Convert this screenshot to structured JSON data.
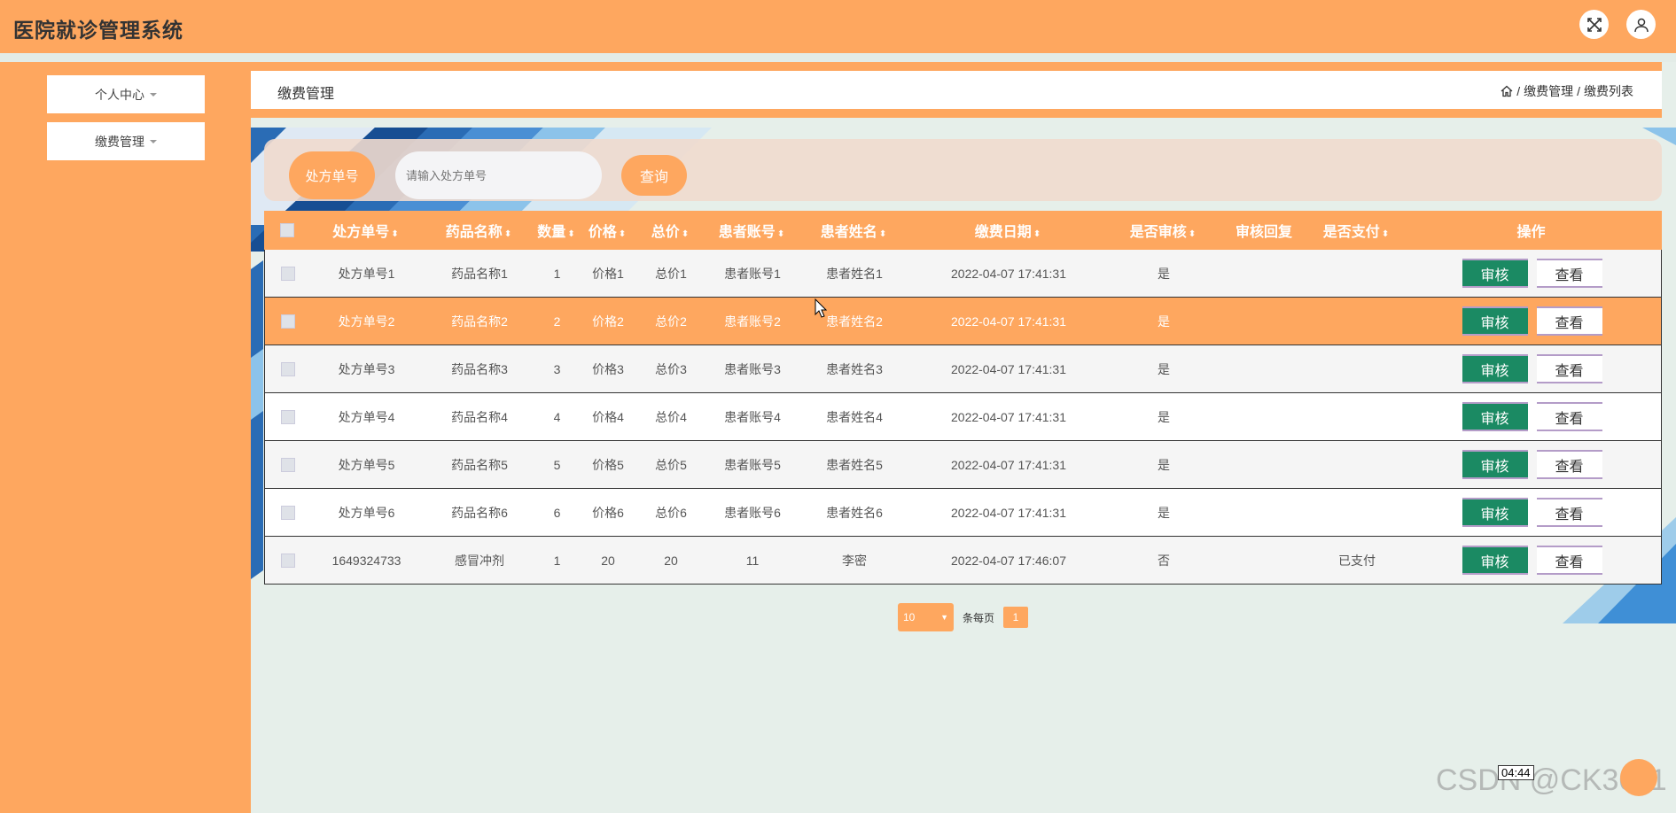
{
  "app": {
    "title": "医院就诊管理系统"
  },
  "sidebar": {
    "items": [
      {
        "label": "个人中心"
      },
      {
        "label": "缴费管理"
      }
    ]
  },
  "header": {
    "page_title": "缴费管理",
    "breadcrumb": [
      "缴费管理",
      "缴费列表"
    ]
  },
  "search": {
    "label": "处方单号",
    "placeholder": "请输入处方单号",
    "button": "查询"
  },
  "table": {
    "columns": [
      "处方单号",
      "药品名称",
      "数量",
      "价格",
      "总价",
      "患者账号",
      "患者姓名",
      "缴费日期",
      "是否审核",
      "审核回复",
      "是否支付",
      "操作"
    ],
    "rows": [
      {
        "id": "处方单号1",
        "drug": "药品名称1",
        "qty": "1",
        "price": "价格1",
        "total": "总价1",
        "account": "患者账号1",
        "name": "患者姓名1",
        "date": "2022-04-07 17:41:31",
        "audited": "是",
        "reply": "",
        "paid": ""
      },
      {
        "id": "处方单号2",
        "drug": "药品名称2",
        "qty": "2",
        "price": "价格2",
        "total": "总价2",
        "account": "患者账号2",
        "name": "患者姓名2",
        "date": "2022-04-07 17:41:31",
        "audited": "是",
        "reply": "",
        "paid": ""
      },
      {
        "id": "处方单号3",
        "drug": "药品名称3",
        "qty": "3",
        "price": "价格3",
        "total": "总价3",
        "account": "患者账号3",
        "name": "患者姓名3",
        "date": "2022-04-07 17:41:31",
        "audited": "是",
        "reply": "",
        "paid": ""
      },
      {
        "id": "处方单号4",
        "drug": "药品名称4",
        "qty": "4",
        "price": "价格4",
        "total": "总价4",
        "account": "患者账号4",
        "name": "患者姓名4",
        "date": "2022-04-07 17:41:31",
        "audited": "是",
        "reply": "",
        "paid": ""
      },
      {
        "id": "处方单号5",
        "drug": "药品名称5",
        "qty": "5",
        "price": "价格5",
        "total": "总价5",
        "account": "患者账号5",
        "name": "患者姓名5",
        "date": "2022-04-07 17:41:31",
        "audited": "是",
        "reply": "",
        "paid": ""
      },
      {
        "id": "处方单号6",
        "drug": "药品名称6",
        "qty": "6",
        "price": "价格6",
        "total": "总价6",
        "account": "患者账号6",
        "name": "患者姓名6",
        "date": "2022-04-07 17:41:31",
        "audited": "是",
        "reply": "",
        "paid": ""
      },
      {
        "id": "1649324733",
        "drug": "感冒冲剂",
        "qty": "1",
        "price": "20",
        "total": "20",
        "account": "11",
        "name": "李密",
        "date": "2022-04-07 17:46:07",
        "audited": "否",
        "reply": "",
        "paid": "已支付"
      }
    ],
    "actions": {
      "audit": "审核",
      "view": "查看"
    }
  },
  "pager": {
    "page_size": "10",
    "per_page_label": "条每页",
    "current_page": "1"
  },
  "overlay": {
    "time": "04:44",
    "watermark": "CSDN @CK3011"
  },
  "colors": {
    "accent": "#fea75f",
    "audit_button": "#1b8a63",
    "background": "#e6efea"
  },
  "icons": {
    "fullscreen": "fullscreen-icon",
    "user": "user-icon",
    "home": "home-icon"
  }
}
